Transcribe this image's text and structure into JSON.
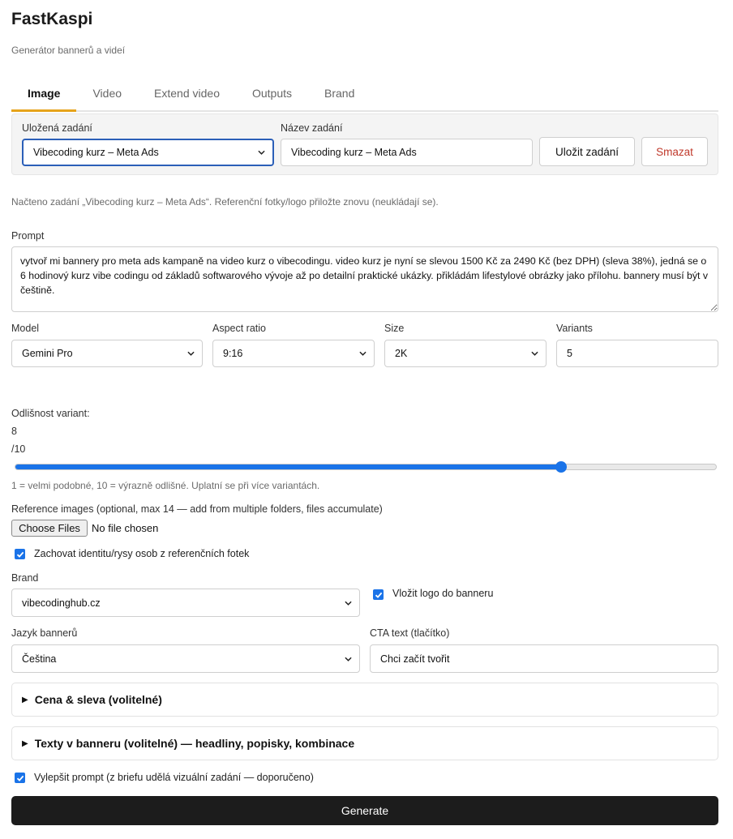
{
  "app": {
    "title": "FastKaspi",
    "subtitle": "Generátor bannerů a videí"
  },
  "tabs": [
    {
      "label": "Image",
      "active": true
    },
    {
      "label": "Video",
      "active": false
    },
    {
      "label": "Extend video",
      "active": false
    },
    {
      "label": "Outputs",
      "active": false
    },
    {
      "label": "Brand",
      "active": false
    }
  ],
  "saved": {
    "select_label": "Uložená zadání",
    "select_value": "Vibecoding kurz – Meta Ads",
    "name_label": "Název zadání",
    "name_value": "Vibecoding kurz – Meta Ads",
    "save_button": "Uložit zadání",
    "delete_button": "Smazat"
  },
  "loaded_note": "Načteno zadání „Vibecoding kurz – Meta Ads“. Referenční fotky/logo přiložte znovu (neukládají se).",
  "prompt": {
    "label": "Prompt",
    "value": "vytvoř mi bannery pro meta ads kampaně na video kurz o vibecodingu. video kurz je nyní se slevou 1500 Kč za 2490 Kč (bez DPH) (sleva 38%), jedná se o 6 hodinový kurz vibe codingu od základů softwarového vývoje až po detailní praktické ukázky. přikládám lifestylové obrázky jako přílohu. bannery musí být v češtině."
  },
  "model": {
    "label": "Model",
    "value": "Gemini Pro"
  },
  "aspect_ratio": {
    "label": "Aspect ratio",
    "value": "9:16"
  },
  "size": {
    "label": "Size",
    "value": "2K"
  },
  "variants": {
    "label": "Variants",
    "value": "5"
  },
  "variance": {
    "label": "Odlišnost variant:",
    "value": "8",
    "max": "/10",
    "level_fraction": 0.778,
    "hint": "1 = velmi podobné, 10 = výrazně odlišné. Uplatní se při více variantách."
  },
  "reference": {
    "label": "Reference images (optional, max 14 — add from multiple folders, files accumulate)",
    "button": "Choose Files",
    "status": "No file chosen"
  },
  "keep_identity": {
    "label": "Zachovat identitu/rysy osob z referenčních fotek",
    "checked": true
  },
  "brand": {
    "label": "Brand",
    "value": "vibecodinghub.cz"
  },
  "insert_logo": {
    "label": "Vložit logo do banneru",
    "checked": true
  },
  "language": {
    "label": "Jazyk bannerů",
    "value": "Čeština"
  },
  "cta": {
    "label": "CTA text (tlačítko)",
    "value": "Chci začít tvořit"
  },
  "sections": {
    "price": "Cena & sleva (volitelné)",
    "texts": "Texty v banneru (volitelné) — headliny, popisky, kombinace"
  },
  "improve_prompt": {
    "label": "Vylepšit prompt (z briefu udělá vizuální zadání — doporučeno)",
    "checked": true
  },
  "generate_button": "Generate",
  "colors": {
    "accent_tab": "#e6a31a",
    "primary": "#1a73e8",
    "danger": "#c0392b",
    "generate_bg": "#1c1c1c"
  },
  "icons": {
    "select_arrow": "chevron-down-icon",
    "checkbox": "check-icon",
    "disclosure": "triangle-right-icon"
  }
}
